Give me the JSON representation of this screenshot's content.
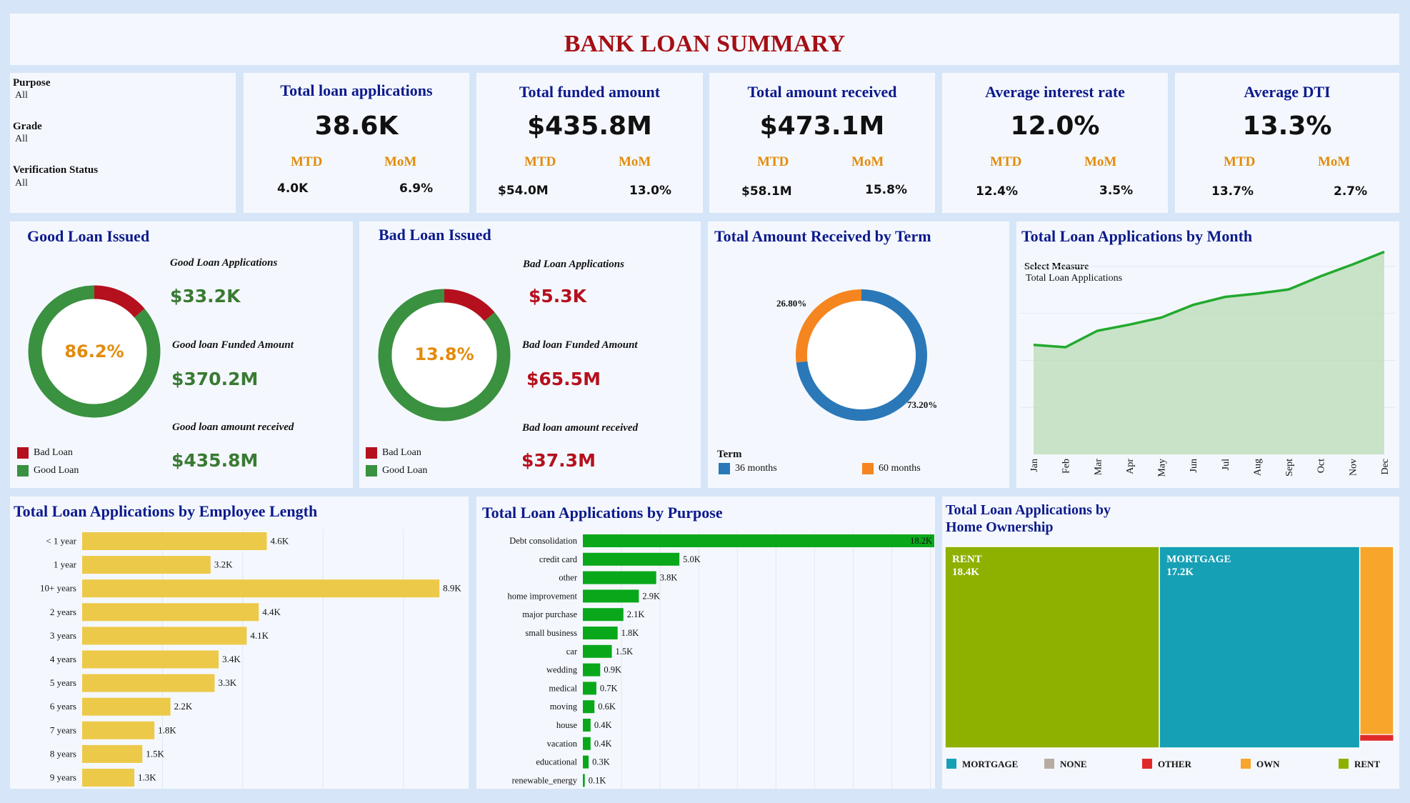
{
  "header": {
    "title": "BANK LOAN SUMMARY"
  },
  "filters": [
    {
      "label": "Purpose",
      "value": "All"
    },
    {
      "label": "Grade",
      "value": "All"
    },
    {
      "label": "Verification Status",
      "value": "All"
    }
  ],
  "kpis": [
    {
      "title": "Total loan applications",
      "value": "38.6K",
      "mtd_label": "MTD",
      "mom_label": "MoM",
      "mtd": "4.0K",
      "mom": "6.9%"
    },
    {
      "title": "Total funded amount",
      "value": "$435.8M",
      "mtd_label": "MTD",
      "mom_label": "MoM",
      "mtd": "$54.0M",
      "mom": "13.0%"
    },
    {
      "title": "Total amount received",
      "value": "$473.1M",
      "mtd_label": "MTD",
      "mom_label": "MoM",
      "mtd": "$58.1M",
      "mom": "15.8%"
    },
    {
      "title": "Average interest rate",
      "value": "12.0%",
      "mtd_label": "MTD",
      "mom_label": "MoM",
      "mtd": "12.4%",
      "mom": "3.5%"
    },
    {
      "title": "Average DTI",
      "value": "13.3%",
      "mtd_label": "MTD",
      "mom_label": "MoM",
      "mtd": "13.7%",
      "mom": "2.7%"
    }
  ],
  "good_loan": {
    "title": "Good Loan Issued",
    "percent_label": "86.2%",
    "applications_label": "Good Loan Applications",
    "applications_value": "$33.2K",
    "funded_label": "Good loan Funded Amount",
    "funded_value": "$370.2M",
    "received_label": "Good loan amount received",
    "received_value": "$435.8M",
    "legend": [
      "Bad Loan",
      "Good Loan"
    ]
  },
  "bad_loan": {
    "title": "Bad Loan Issued",
    "percent_label": "13.8%",
    "applications_label": "Bad Loan Applications",
    "applications_value": "$5.3K",
    "funded_label": "Bad loan Funded Amount",
    "funded_value": "$65.5M",
    "received_label": "Bad loan amount received",
    "received_value": "$37.3M",
    "legend": [
      "Bad Loan",
      "Good Loan"
    ]
  },
  "term_panel": {
    "title": "Total Amount Received by Term",
    "legend_title": "Term",
    "legend": [
      "36 months",
      "60 months"
    ]
  },
  "month_panel": {
    "title": "Total Loan Applications by Month",
    "measure_label": "Select Measure",
    "measure_value": "Total Loan Applications"
  },
  "emp_panel": {
    "title": "Total Loan Applications by Employee Length"
  },
  "purpose_panel": {
    "title": "Total Loan Applications by Purpose"
  },
  "home_panel": {
    "title_line1": "Total Loan Applications by",
    "title_line2": "Home Ownership",
    "legend": [
      "MORTGAGE",
      "NONE",
      "OTHER",
      "OWN",
      "RENT"
    ]
  },
  "colors": {
    "good": "#3a913f",
    "bad": "#b5101e",
    "accent_orange": "#e38b0c",
    "title_blue": "#0d1a8c",
    "header_red": "#a50f15",
    "term_36": "#2a78b8",
    "term_60": "#f5851f",
    "employee_bar": "#edc949",
    "purpose_bar": "#09a81b",
    "line": "#22a92e",
    "rent": "#8eb100",
    "mortgage": "#16a0b5",
    "own": "#f7a52b",
    "other": "#e02a2a",
    "none": "#b8aca2"
  },
  "chart_data": [
    {
      "type": "pie",
      "name": "good-loan-donut",
      "categories": [
        "Good Loan",
        "Bad Loan"
      ],
      "values": [
        86.2,
        13.8
      ],
      "center_label": "86.2%"
    },
    {
      "type": "pie",
      "name": "bad-loan-donut",
      "categories": [
        "Bad Loan",
        "Good Loan"
      ],
      "values": [
        13.8,
        86.2
      ],
      "center_label": "13.8%"
    },
    {
      "type": "pie",
      "name": "term-donut",
      "title": "Total Amount Received by Term",
      "categories": [
        "36 months",
        "60 months"
      ],
      "values": [
        73.2,
        26.8
      ],
      "data_labels": [
        "73.20%",
        "26.80%"
      ],
      "legend": "bottom"
    },
    {
      "type": "area",
      "name": "month-line",
      "title": "Total Loan Applications by Month",
      "x": [
        "Jan",
        "Feb",
        "Mar",
        "Apr",
        "May",
        "Jun",
        "Jul",
        "Aug",
        "Sept",
        "Oct",
        "Nov",
        "Dec"
      ],
      "values": [
        2330,
        2280,
        2630,
        2760,
        2910,
        3180,
        3350,
        3420,
        3510,
        3790,
        4040,
        4310
      ],
      "ylim": [
        0,
        4500
      ],
      "grid": true
    },
    {
      "type": "bar",
      "name": "employee-length",
      "title": "Total Loan Applications by Employee Length",
      "orientation": "horizontal",
      "categories": [
        "< 1 year",
        "1 year",
        "10+ years",
        "2 years",
        "3 years",
        "4 years",
        "5 years",
        "6 years",
        "7 years",
        "8 years",
        "9 years"
      ],
      "values": [
        4.6,
        3.2,
        8.9,
        4.4,
        4.1,
        3.4,
        3.3,
        2.2,
        1.8,
        1.5,
        1.3
      ],
      "labels": [
        "4.6K",
        "3.2K",
        "8.9K",
        "4.4K",
        "4.1K",
        "3.4K",
        "3.3K",
        "2.2K",
        "1.8K",
        "1.5K",
        "1.3K"
      ],
      "xlim": [
        0,
        10
      ],
      "grid": true
    },
    {
      "type": "bar",
      "name": "purpose",
      "title": "Total Loan Applications by Purpose",
      "orientation": "horizontal",
      "categories": [
        "Debt consolidation",
        "credit card",
        "other",
        "home improvement",
        "major purchase",
        "small business",
        "car",
        "wedding",
        "medical",
        "moving",
        "house",
        "vacation",
        "educational",
        "renewable_energy"
      ],
      "values": [
        18.2,
        5.0,
        3.8,
        2.9,
        2.1,
        1.8,
        1.5,
        0.9,
        0.7,
        0.6,
        0.4,
        0.4,
        0.3,
        0.1
      ],
      "labels": [
        "18.2K",
        "5.0K",
        "3.8K",
        "2.9K",
        "2.1K",
        "1.8K",
        "1.5K",
        "0.9K",
        "0.7K",
        "0.6K",
        "0.4K",
        "0.4K",
        "0.3K",
        "0.1K"
      ],
      "xlim": [
        0,
        18.2
      ],
      "grid": true
    },
    {
      "type": "treemap",
      "name": "home-ownership",
      "title": "Total Loan Applications by Home Ownership",
      "categories": [
        "RENT",
        "MORTGAGE",
        "OWN",
        "OTHER",
        "NONE"
      ],
      "values": [
        18.4,
        17.2,
        2.8,
        0.1,
        0.0
      ],
      "labels": [
        "RENT\n18.4K",
        "MORTGAGE\n17.2K",
        "",
        "",
        ""
      ],
      "legend": "bottom"
    }
  ]
}
